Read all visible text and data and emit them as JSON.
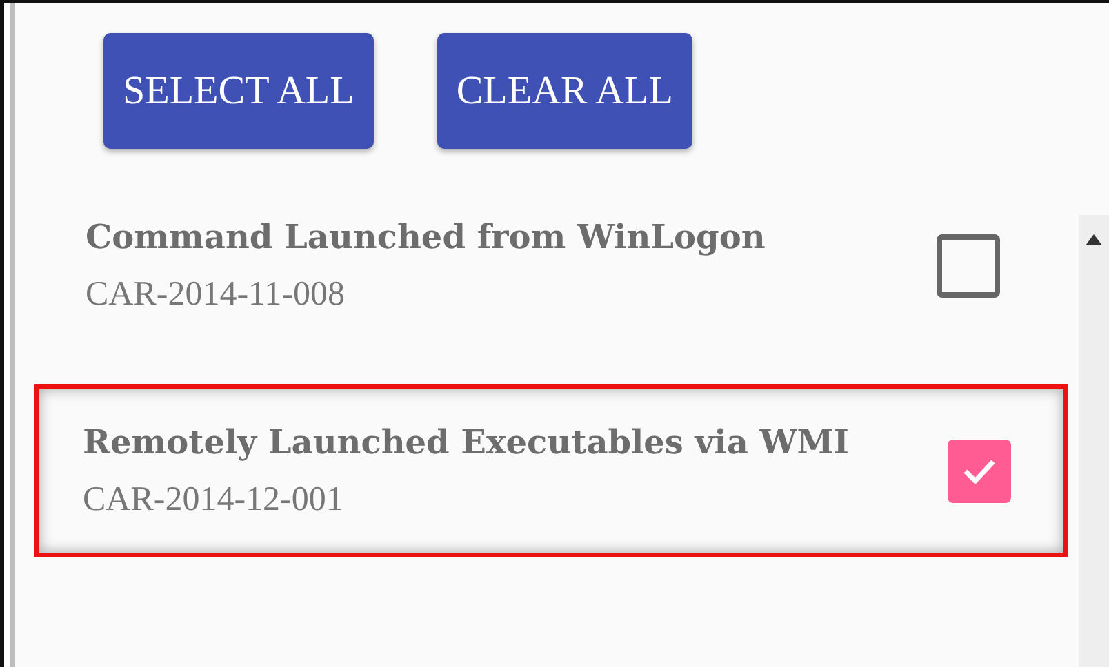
{
  "buttons": [
    {
      "label": "SELECT ALL"
    },
    {
      "label": "CLEAR ALL"
    }
  ],
  "items": [
    {
      "title": "Command Launched from WinLogon",
      "id": "CAR-2014-11-008",
      "checked": false,
      "highlighted": false
    },
    {
      "title": "Remotely Launched Executables via WMI",
      "id": "CAR-2014-12-001",
      "checked": true,
      "highlighted": true
    }
  ]
}
